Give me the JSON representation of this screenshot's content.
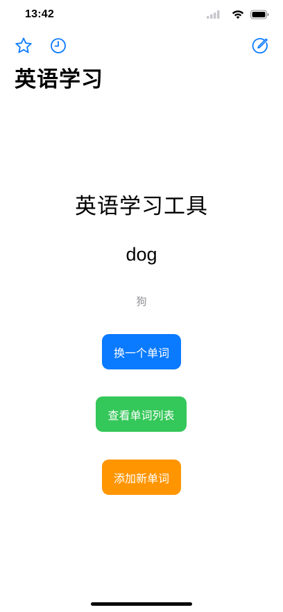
{
  "status_bar": {
    "time": "13:42"
  },
  "nav": {
    "title": "英语学习",
    "favorites_icon": "star-icon",
    "history_icon": "clock-icon",
    "edit_icon": "compose-icon"
  },
  "main": {
    "heading": "英语学习工具",
    "word": "dog",
    "translation": "狗"
  },
  "buttons": {
    "next_word": "换一个单词",
    "view_list": "查看单词列表",
    "add_word": "添加新单词"
  },
  "colors": {
    "accent": "#0a7aff",
    "blue_button": "#0a7aff",
    "green_button": "#34c759",
    "orange_button": "#ff9500",
    "secondary_text": "#8e8e93"
  }
}
